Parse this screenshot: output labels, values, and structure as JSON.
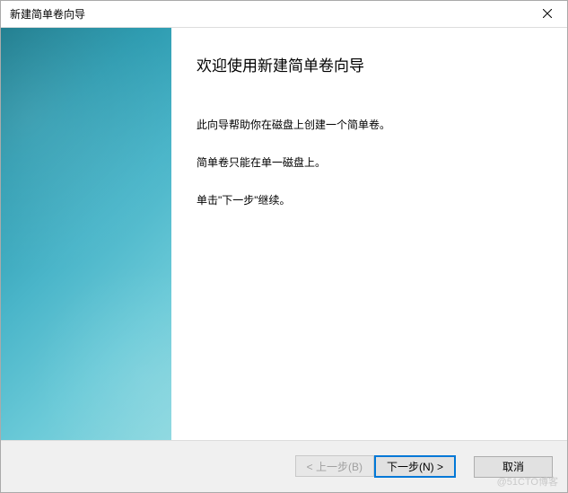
{
  "window": {
    "title": "新建简单卷向导"
  },
  "content": {
    "heading": "欢迎使用新建简单卷向导",
    "line1": "此向导帮助你在磁盘上创建一个简单卷。",
    "line2": "简单卷只能在单一磁盘上。",
    "line3": "单击\"下一步\"继续。"
  },
  "buttons": {
    "back": "< 上一步(B)",
    "next": "下一步(N) >",
    "cancel": "取消"
  },
  "watermark": "@51CTO博客"
}
